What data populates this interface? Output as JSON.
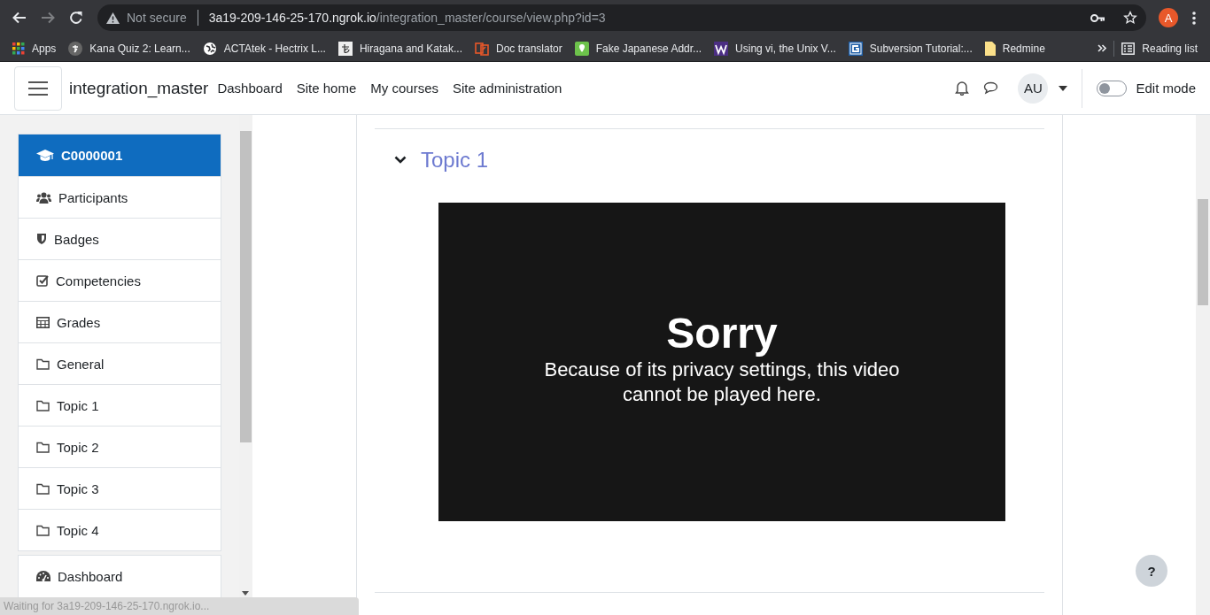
{
  "browser": {
    "address": {
      "security": "Not secure",
      "host": "3a19-209-146-25-170.ngrok.io",
      "path": "/integration_master/course/view.php?id=3"
    },
    "profile": "A",
    "bookmarks": [
      {
        "label": "Apps",
        "kind": "apps"
      },
      {
        "label": "Kana Quiz 2: Learn...",
        "kind": "kana"
      },
      {
        "label": "ACTAtek - Hectrix L...",
        "kind": "globe"
      },
      {
        "label": "Hiragana and Katak...",
        "kind": "hiragana"
      },
      {
        "label": "Doc translator",
        "kind": "doc"
      },
      {
        "label": "Fake Japanese Addr...",
        "kind": "pin"
      },
      {
        "label": "Using vi, the Unix V...",
        "kind": "w"
      },
      {
        "label": "Subversion Tutorial:...",
        "kind": "svn"
      },
      {
        "label": "Redmine",
        "kind": "note"
      }
    ],
    "reading_list": "Reading list"
  },
  "navbar": {
    "site_name": "integration_master",
    "links": [
      "Dashboard",
      "Site home",
      "My courses",
      "Site administration"
    ],
    "user": "AU",
    "edit_mode": {
      "label": "Edit mode",
      "on": false
    }
  },
  "drawer": {
    "course": {
      "label": "C0000001",
      "selected": true
    },
    "items": [
      {
        "label": "Participants",
        "kind": "users"
      },
      {
        "label": "Badges",
        "kind": "shield"
      },
      {
        "label": "Competencies",
        "kind": "check"
      },
      {
        "label": "Grades",
        "kind": "table"
      },
      {
        "label": "General",
        "kind": "folder"
      },
      {
        "label": "Topic 1",
        "kind": "folder"
      },
      {
        "label": "Topic 2",
        "kind": "folder"
      },
      {
        "label": "Topic 3",
        "kind": "folder"
      },
      {
        "label": "Topic 4",
        "kind": "folder"
      }
    ],
    "links": [
      {
        "label": "Dashboard",
        "kind": "gauge"
      }
    ]
  },
  "section": {
    "title": "Topic 1",
    "expanded": true,
    "video": {
      "title": "Sorry",
      "message": "Because of its privacy settings, this video cannot be played here."
    }
  },
  "help": "?",
  "status_bar": "Waiting for 3a19-209-146-25-170.ngrok.io..."
}
